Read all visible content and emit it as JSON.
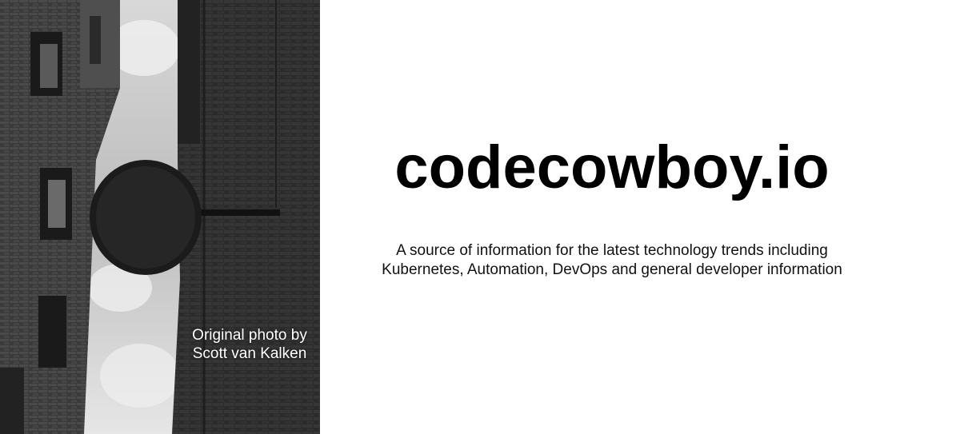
{
  "hero": {
    "photo_credit": {
      "line1": "Original photo by",
      "line2": "Scott van Kalken"
    }
  },
  "site": {
    "title": "codecowboy.io",
    "tagline": {
      "line1": "A source of information for the latest technology trends including",
      "line2": "Kubernetes, Automation, DevOps and general developer information"
    }
  }
}
